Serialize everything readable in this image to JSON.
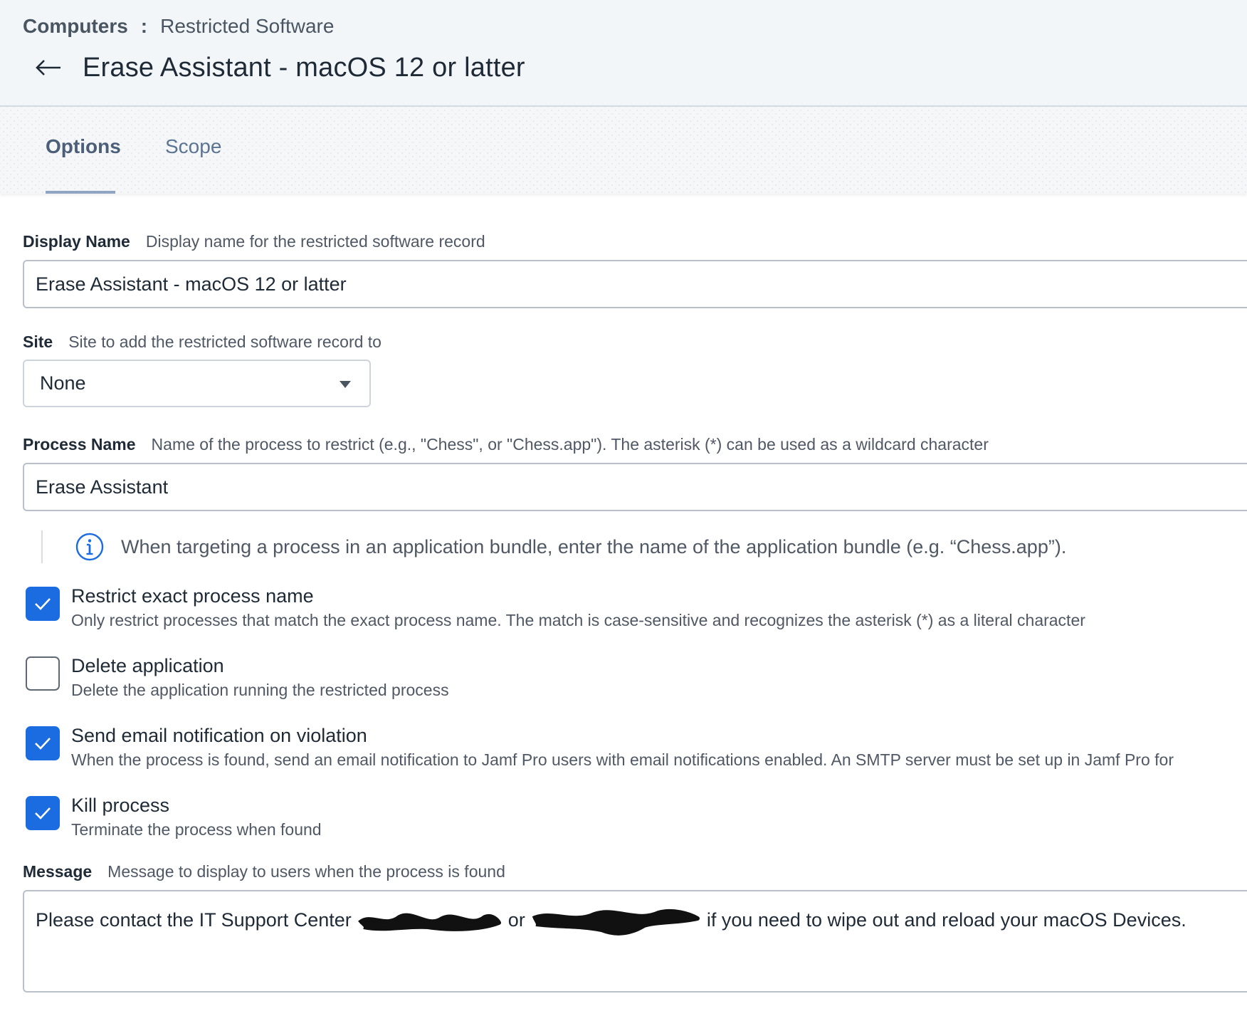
{
  "breadcrumb": {
    "root": "Computers",
    "separator": ":",
    "current": "Restricted Software"
  },
  "page": {
    "title": "Erase Assistant - macOS 12 or latter"
  },
  "tabs": [
    {
      "label": "Options",
      "active": true
    },
    {
      "label": "Scope",
      "active": false
    }
  ],
  "form": {
    "display_name": {
      "label": "Display Name",
      "help": "Display name for the restricted software record",
      "value": "Erase Assistant - macOS 12 or latter"
    },
    "site": {
      "label": "Site",
      "help": "Site to add the restricted software record to",
      "value": "None"
    },
    "process_name": {
      "label": "Process Name",
      "help": "Name of the process to restrict (e.g., \"Chess\", or \"Chess.app\"). The asterisk (*) can be used as a wildcard character",
      "value": "Erase Assistant"
    },
    "info_note": "When targeting a process in an application bundle, enter the name of the application bundle (e.g. “Chess.app”).",
    "options": [
      {
        "title": "Restrict exact process name",
        "description": "Only restrict processes that match the exact process name. The match is case-sensitive and recognizes the asterisk (*) as a literal character",
        "checked": true
      },
      {
        "title": "Delete application",
        "description": "Delete the application running the restricted process",
        "checked": false
      },
      {
        "title": "Send email notification on violation",
        "description": "When the process is found, send an email notification to Jamf Pro users with email notifications enabled. An SMTP server must be set up in Jamf Pro for",
        "checked": true
      },
      {
        "title": "Kill process",
        "description": "Terminate the process when found",
        "checked": true
      }
    ],
    "message": {
      "label": "Message",
      "help": "Message to display to users when the process is found",
      "value_start": "Please contact the IT Support Center",
      "value_middle": "or",
      "value_end": "if you need to wipe out and reload your macOS Devices."
    }
  },
  "colors": {
    "accent": "#1a6ce0",
    "header_bg": "#f3f6f9",
    "tab_active": "#4b5f79"
  },
  "icons": {
    "back": "arrow-left-icon",
    "info": "info-circle-icon",
    "check": "checkmark-icon",
    "caret": "caret-down-icon"
  }
}
